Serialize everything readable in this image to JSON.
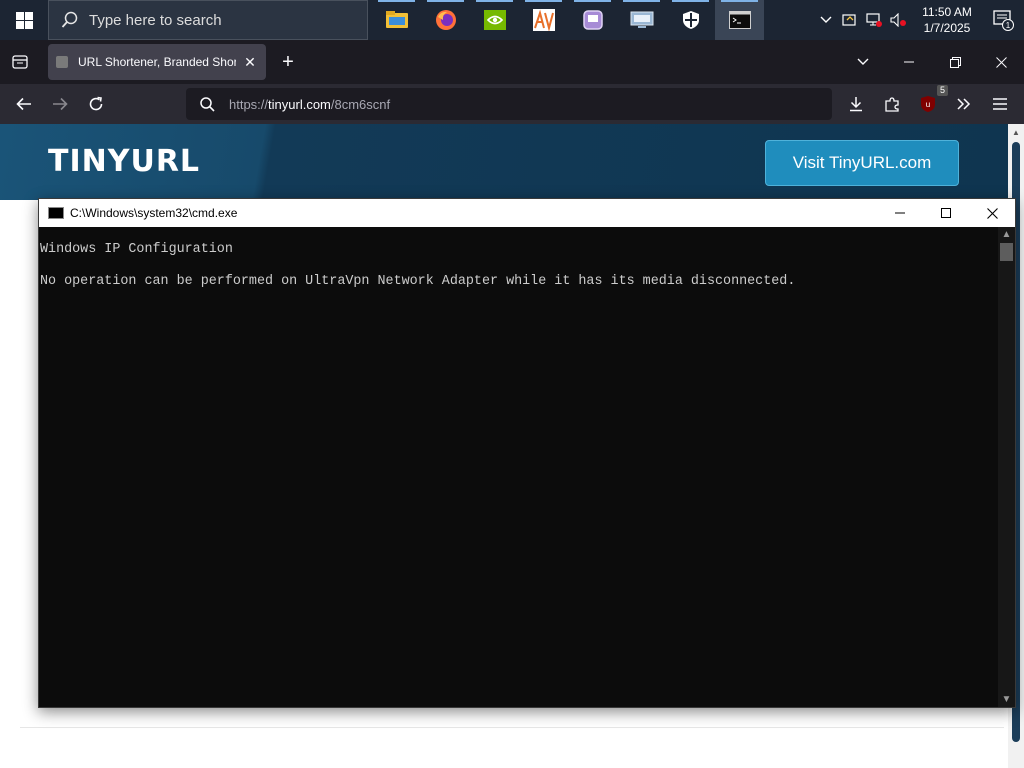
{
  "taskbar": {
    "search_placeholder": "Type here to search",
    "apps": [
      {
        "name": "file-explorer-icon",
        "color": "#f2c037"
      },
      {
        "name": "firefox-icon",
        "color": "#ff7139"
      },
      {
        "name": "nvidia-icon",
        "color": "#76b900"
      },
      {
        "name": "av-icon",
        "color": "#e8702a"
      },
      {
        "name": "app-purple-icon",
        "color": "#a78bd6"
      },
      {
        "name": "remote-desktop-icon",
        "color": "#9ab7d4"
      },
      {
        "name": "security-shield-icon",
        "color": "#ffffff"
      },
      {
        "name": "cmd-icon",
        "color": "#ffffff"
      }
    ],
    "clock_time": "11:50 AM",
    "clock_date": "1/7/2025",
    "notification_count": "1"
  },
  "browser": {
    "tab_title": "URL Shortener, Branded Short L",
    "url_protocol": "https://",
    "url_host": "tinyurl.com",
    "url_path": "/8cm6scnf",
    "extension_badge": "5"
  },
  "page": {
    "logo": "TINYURL",
    "visit_button": "Visit TinyURL.com"
  },
  "cmd": {
    "title": "C:\\Windows\\system32\\cmd.exe",
    "lines": [
      "Windows IP Configuration",
      "",
      "No operation can be performed on UltraVpn Network Adapter while it has its media disconnected."
    ]
  },
  "colors": {
    "taskbar_bg": "#1c2533",
    "browser_bg": "#1c1b22",
    "header_bg": "#123a57",
    "button_bg": "#1f8dbd",
    "console_bg": "#0c0c0c"
  }
}
